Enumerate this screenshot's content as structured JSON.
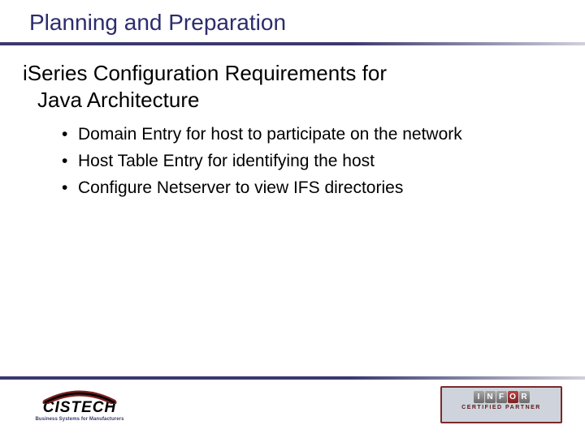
{
  "title": "Planning and Preparation",
  "subtitle_line1": "iSeries Configuration Requirements for",
  "subtitle_line2": "Java Architecture",
  "bullets": [
    "Domain Entry for host to participate on the network",
    "Host Table Entry for identifying the host",
    "Configure Netserver to view IFS directories"
  ],
  "logos": {
    "cistech": {
      "name": "CISTECH",
      "tagline": "Business Systems for Manufacturers"
    },
    "infor": {
      "letters": [
        "I",
        "N",
        "F",
        "O",
        "R"
      ],
      "partner": "CERTIFIED PARTNER"
    }
  }
}
